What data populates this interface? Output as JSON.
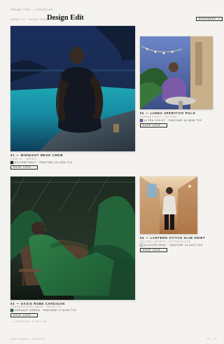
{
  "header": {
    "kicker": "Issue 07 · Night Rush Series",
    "title": "Design Edit",
    "top_small": "Frame One · Lookbook",
    "bookmark_label": "Bookmark ↗"
  },
  "items": [
    {
      "index_title": "01 — Midnight Mesh Crew",
      "subtitle": "Look 01 · Jersey",
      "swatch_label": "Eclipse Navy · Pantone 19-4026 TCX",
      "swatch_color": "#1f2432",
      "button": "Shop Look →"
    },
    {
      "index_title": "02 — Lunes Aperitivo Polo",
      "subtitle": "Terrace Knit · Cotton",
      "swatch_label": "Ultra Violet · Pantone 18-3838 TCX",
      "swatch_color": "#6f5aa5",
      "button": "Shop Look →"
    },
    {
      "index_title": "03 — Oasis Robe Cardigan",
      "subtitle": "Conservatory Wear · Relax Fit",
      "swatch_label": "Verdant Green · Pantone 17-6153 TCX",
      "swatch_color": "#2d6a3f",
      "button": "Shop Look →",
      "note": "— Lookbook In Motion"
    },
    {
      "index_title": "04 — Lantern Stitch Slim Shirt",
      "subtitle": "Hallway Nights · Cotton Blend",
      "swatch_label": "Glacier Gray · Pantone 14-4102 TCX",
      "swatch_color": "#c7ccd1",
      "button": "Shop Look →"
    }
  ],
  "footer": {
    "left": "Don't miss — Nights",
    "right": "07 / 07"
  }
}
